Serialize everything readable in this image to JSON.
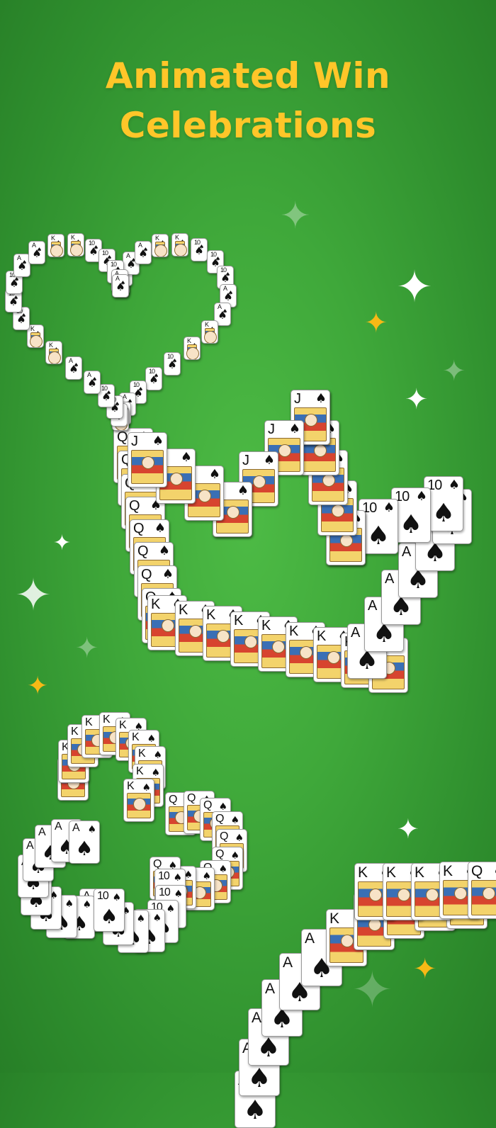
{
  "headline": {
    "line1": "Animated Win",
    "line2": "Celebrations"
  },
  "colors": {
    "headline": "#ffc629",
    "background": "#3fa83a",
    "sparkle_white": "#ffffff",
    "sparkle_gold": "#f7b916",
    "card_face": "#ffffff",
    "suit_black": "#111111"
  },
  "shapes": {
    "heart": {
      "suit": "♠",
      "ranks": [
        "10",
        "A",
        "K"
      ]
    },
    "crown": {
      "suit": "♠",
      "ranks": [
        "Q",
        "J",
        "10",
        "A",
        "K"
      ]
    },
    "club": {
      "suit": "♠",
      "ranks": [
        "K",
        "Q",
        "A",
        "10"
      ]
    },
    "spiral": {
      "suit": "♠",
      "ranks": [
        "A",
        "K",
        "Q"
      ]
    }
  },
  "sparkle_icon": "four-point-star-icon"
}
